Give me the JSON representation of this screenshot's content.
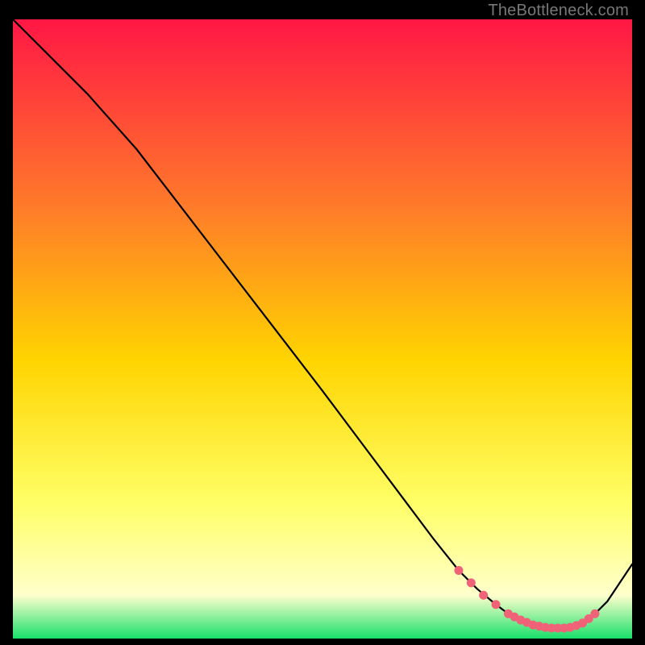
{
  "watermark": "TheBottleneck.com",
  "colors": {
    "gradient_top": "#ff1745",
    "gradient_upper_mid": "#ff7a2a",
    "gradient_mid": "#ffd400",
    "gradient_lower_mid": "#ffff66",
    "gradient_pale": "#ffffcc",
    "gradient_bottom": "#18e06a",
    "curve": "#000000",
    "marker": "#f06277",
    "frame": "#000000"
  },
  "chart_data": {
    "type": "line",
    "title": "",
    "xlabel": "",
    "ylabel": "",
    "xlim": [
      0,
      100
    ],
    "ylim": [
      0,
      100
    ],
    "series": [
      {
        "name": "bottleneck-curve",
        "x": [
          0,
          6,
          12,
          20,
          30,
          40,
          50,
          56,
          62,
          68,
          72,
          75,
          78,
          80,
          82,
          84,
          86,
          88,
          90,
          92,
          94,
          96,
          98,
          100
        ],
        "values": [
          100,
          94,
          88,
          79,
          66,
          53,
          40,
          32,
          24,
          16,
          11,
          8,
          5.5,
          4,
          3,
          2.2,
          1.8,
          1.7,
          1.8,
          2.5,
          4,
          6,
          9,
          12
        ]
      }
    ],
    "markers": {
      "name": "highlight-points",
      "x": [
        72,
        74,
        76,
        78,
        80,
        81,
        82,
        83,
        84,
        85,
        86,
        87,
        88,
        89,
        90,
        91,
        92,
        93,
        94
      ],
      "values": [
        11,
        9,
        7,
        5.5,
        4,
        3.5,
        3,
        2.6,
        2.2,
        2,
        1.8,
        1.7,
        1.7,
        1.7,
        1.8,
        2.1,
        2.5,
        3.2,
        4
      ]
    }
  }
}
